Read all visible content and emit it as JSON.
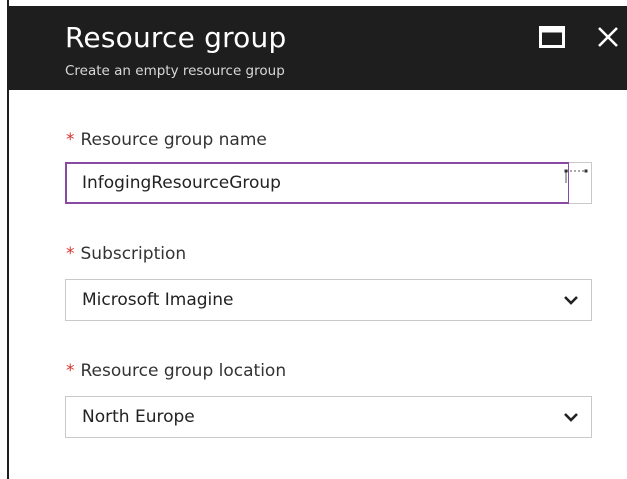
{
  "blade": {
    "title": "Resource group",
    "subtitle": "Create an empty resource group"
  },
  "form": {
    "required_marker": "*",
    "resource_group_name": {
      "label": "Resource group name",
      "value": "InfogingResourceGroup"
    },
    "subscription": {
      "label": "Subscription",
      "value": "Microsoft Imagine"
    },
    "location": {
      "label": "Resource group location",
      "value": "North Europe"
    }
  },
  "colors": {
    "header_background": "#1e1e1e",
    "required_star": "#d8322d",
    "focus_border": "#8a4aa3"
  },
  "icons": [
    "maximize-icon",
    "close-icon",
    "resize-handle-icon",
    "chevron-down-icon"
  ]
}
